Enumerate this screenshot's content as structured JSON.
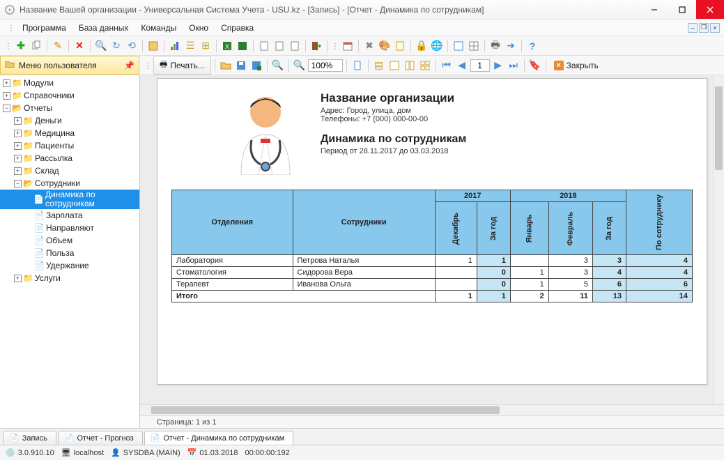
{
  "title": "Название Вашей организации - Универсальная Система Учета - USU.kz - [Запись] - [Отчет - Динамика по сотрудникам]",
  "menus": [
    "Программа",
    "База данных",
    "Команды",
    "Окно",
    "Справка"
  ],
  "usermenu_header": "Меню пользователя",
  "print_label": "Печать...",
  "zoom_value": "100%",
  "page_value": "1",
  "close_label": "Закрыть",
  "tree": {
    "modules": "Модули",
    "sprav": "Справочники",
    "reports": "Отчеты",
    "money": "Деньги",
    "medicine": "Медицина",
    "patients": "Пациенты",
    "mailing": "Рассылка",
    "warehouse": "Склад",
    "employees": "Сотрудники",
    "dynamics": "Динамика по сотрудникам",
    "salary": "Зарплата",
    "refer": "Направляют",
    "volume": "Объем",
    "benefit": "Польза",
    "retention": "Удержание",
    "services": "Услуги"
  },
  "report": {
    "org_title": "Название организации",
    "address": "Адрес: Город, улица, дом",
    "phones": "Телефоны: +7 (000) 000-00-00",
    "rep_title": "Динамика по сотрудникам",
    "period": "Период от 28.11.2017 до 03.03.2018",
    "col_dept": "Отделения",
    "col_emp": "Сотрудники",
    "y2017": "2017",
    "y2018": "2018",
    "m_dec": "Декабрь",
    "for_year": "За год",
    "m_jan": "Январь",
    "m_feb": "Февраль",
    "by_emp": "По сотруднику",
    "rows": [
      {
        "dept": "Лаборатория",
        "emp": "Петрова Наталья",
        "dec": "1",
        "y17": "1",
        "jan": "",
        "feb": "3",
        "y18": "3",
        "tot": "4"
      },
      {
        "dept": "Стоматология",
        "emp": "Сидорова Вера",
        "dec": "",
        "y17": "0",
        "jan": "1",
        "feb": "3",
        "y18": "4",
        "tot": "4"
      },
      {
        "dept": "Терапевт",
        "emp": "Иванова Ольга",
        "dec": "",
        "y17": "0",
        "jan": "1",
        "feb": "5",
        "y18": "6",
        "tot": "6"
      }
    ],
    "total_label": "Итого",
    "total": {
      "dec": "1",
      "y17": "1",
      "jan": "2",
      "feb": "11",
      "y18": "13",
      "tot": "14"
    }
  },
  "page_status": "Страница: 1 из 1",
  "tabs": {
    "record": "Запись",
    "forecast": "Отчет - Прогноз",
    "current": "Отчет - Динамика по сотрудникам"
  },
  "status": {
    "version": "3.0.910.10",
    "host": "localhost",
    "user": "SYSDBA (MAIN)",
    "date": "01.03.2018",
    "time": "00:00:00:192"
  }
}
